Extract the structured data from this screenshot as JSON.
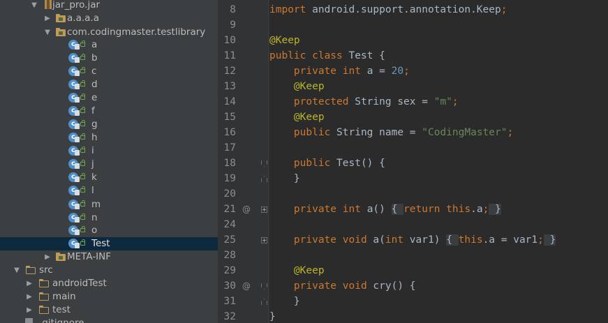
{
  "tree": {
    "items": [
      {
        "label": "jar_pro.jar",
        "icon": "jar-icon",
        "expanded": true
      },
      {
        "label": "a.a.a.a",
        "icon": "package-icon",
        "expanded": false
      },
      {
        "label": "com.codingmaster.testlibrary",
        "icon": "package-icon",
        "expanded": true
      },
      {
        "label": "a",
        "icon": "class-icon"
      },
      {
        "label": "b",
        "icon": "class-icon"
      },
      {
        "label": "c",
        "icon": "class-icon"
      },
      {
        "label": "d",
        "icon": "class-icon"
      },
      {
        "label": "e",
        "icon": "class-icon"
      },
      {
        "label": "f",
        "icon": "class-icon"
      },
      {
        "label": "g",
        "icon": "class-icon"
      },
      {
        "label": "h",
        "icon": "class-icon"
      },
      {
        "label": "i",
        "icon": "class-icon"
      },
      {
        "label": "j",
        "icon": "class-icon"
      },
      {
        "label": "k",
        "icon": "class-icon"
      },
      {
        "label": "l",
        "icon": "class-icon"
      },
      {
        "label": "m",
        "icon": "class-icon"
      },
      {
        "label": "n",
        "icon": "class-icon"
      },
      {
        "label": "o",
        "icon": "class-icon"
      },
      {
        "label": "Test",
        "icon": "class-icon",
        "selected": true
      },
      {
        "label": "META-INF",
        "icon": "package-icon",
        "expanded": false
      },
      {
        "label": "src",
        "icon": "folder-icon",
        "expanded": true
      },
      {
        "label": "androidTest",
        "icon": "folder-icon",
        "expanded": false
      },
      {
        "label": "main",
        "icon": "folder-icon",
        "expanded": false
      },
      {
        "label": "test",
        "icon": "folder-icon",
        "expanded": false
      },
      {
        "label": ".gitignore",
        "icon": "file-icon"
      }
    ]
  },
  "editor": {
    "line_numbers": [
      "8",
      "9",
      "10",
      "11",
      "12",
      "13",
      "14",
      "15",
      "16",
      "17",
      "18",
      "19",
      "20",
      "21",
      "24",
      "25",
      "28",
      "29",
      "30",
      "31",
      "32"
    ],
    "lines": [
      [
        {
          "t": "import ",
          "c": "kw"
        },
        {
          "t": "android.support.annotation.Keep",
          "c": "pl"
        },
        {
          "t": ";",
          "c": "kw"
        }
      ],
      [],
      [
        {
          "t": "@Keep",
          "c": "ann"
        }
      ],
      [
        {
          "t": "public class ",
          "c": "kw"
        },
        {
          "t": "Test {",
          "c": "pl"
        }
      ],
      [
        {
          "t": "    private int ",
          "c": "kw"
        },
        {
          "t": "a = ",
          "c": "fd"
        },
        {
          "t": "20",
          "c": "num"
        },
        {
          "t": ";",
          "c": "kw"
        }
      ],
      [
        {
          "t": "    @Keep",
          "c": "ann"
        }
      ],
      [
        {
          "t": "    protected ",
          "c": "kw"
        },
        {
          "t": "String sex = ",
          "c": "pl"
        },
        {
          "t": "\"m\"",
          "c": "str"
        },
        {
          "t": ";",
          "c": "kw"
        }
      ],
      [
        {
          "t": "    @Keep",
          "c": "ann"
        }
      ],
      [
        {
          "t": "    public ",
          "c": "kw"
        },
        {
          "t": "String name = ",
          "c": "pl"
        },
        {
          "t": "\"CodingMaster\"",
          "c": "str"
        },
        {
          "t": ";",
          "c": "kw"
        }
      ],
      [],
      [
        {
          "t": "    public ",
          "c": "kw"
        },
        {
          "t": "Test() {",
          "c": "pl"
        }
      ],
      [
        {
          "t": "    }",
          "c": "pl"
        }
      ],
      [],
      [
        {
          "t": "    private int ",
          "c": "kw"
        },
        {
          "t": "a() ",
          "c": "pl"
        },
        {
          "t": "{ ",
          "c": "pl br"
        },
        {
          "t": "return this",
          "c": "kw"
        },
        {
          "t": ".a",
          "c": "fd"
        },
        {
          "t": ";",
          "c": "kw"
        },
        {
          "t": " }",
          "c": "pl br"
        }
      ],
      [],
      [
        {
          "t": "    private void ",
          "c": "kw"
        },
        {
          "t": "a(",
          "c": "pl"
        },
        {
          "t": "int ",
          "c": "kw"
        },
        {
          "t": "var1) ",
          "c": "pl"
        },
        {
          "t": "{ ",
          "c": "pl br"
        },
        {
          "t": "this",
          "c": "kw"
        },
        {
          "t": ".a = var1",
          "c": "fd"
        },
        {
          "t": ";",
          "c": "kw"
        },
        {
          "t": " }",
          "c": "pl br"
        }
      ],
      [],
      [
        {
          "t": "    @Keep",
          "c": "ann"
        }
      ],
      [
        {
          "t": "    private void ",
          "c": "kw"
        },
        {
          "t": "cry() {",
          "c": "pl"
        }
      ],
      [
        {
          "t": "    }",
          "c": "pl"
        }
      ],
      [
        {
          "t": "}",
          "c": "pl"
        }
      ]
    ],
    "override_marker": "@"
  }
}
